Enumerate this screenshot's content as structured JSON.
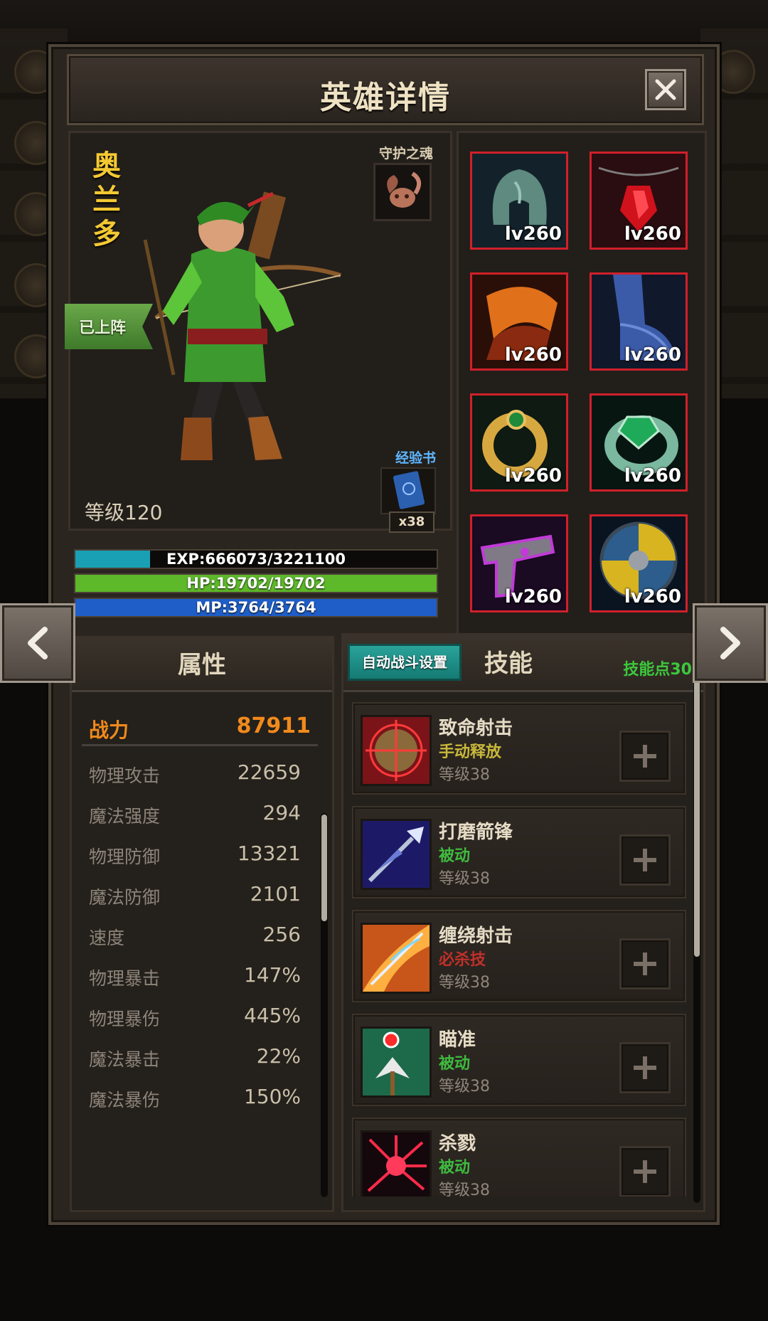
{
  "window": {
    "title": "英雄详情"
  },
  "hero": {
    "name": "奥兰多",
    "deployed_badge": "已上阵",
    "soul_label": "守护之魂",
    "expbook_label": "经验书",
    "expbook_count": "x38",
    "level_text": "等级120",
    "exp_text": "EXP:666073/3221100",
    "exp_fraction": 0.207,
    "hp_text": "HP:19702/19702",
    "hp_fraction": 1.0,
    "mp_text": "MP:3764/3764",
    "mp_fraction": 1.0
  },
  "equipment": [
    {
      "icon": "helmet-icon",
      "level": "lv260"
    },
    {
      "icon": "red-gem-necklace-icon",
      "level": "lv260"
    },
    {
      "icon": "cloak-icon",
      "level": "lv260"
    },
    {
      "icon": "boots-icon",
      "level": "lv260"
    },
    {
      "icon": "gold-ring-icon",
      "level": "lv260"
    },
    {
      "icon": "emerald-ring-icon",
      "level": "lv260"
    },
    {
      "icon": "purple-gun-icon",
      "level": "lv260"
    },
    {
      "icon": "round-shield-icon",
      "level": "lv260"
    }
  ],
  "attributes": {
    "header": "属性",
    "power_label": "战力",
    "power_value": "87911",
    "stats": [
      {
        "label": "物理攻击",
        "value": "22659"
      },
      {
        "label": "魔法强度",
        "value": "294"
      },
      {
        "label": "物理防御",
        "value": "13321"
      },
      {
        "label": "魔法防御",
        "value": "2101"
      },
      {
        "label": "速度",
        "value": "256"
      },
      {
        "label": "物理暴击",
        "value": "147%"
      },
      {
        "label": "物理暴伤",
        "value": "445%"
      },
      {
        "label": "魔法暴击",
        "value": "22%"
      },
      {
        "label": "魔法暴伤",
        "value": "150%"
      }
    ]
  },
  "skills": {
    "auto_battle_label": "自动战斗设置",
    "header": "技能",
    "skill_points": "技能点30",
    "list": [
      {
        "name": "致命射击",
        "type": "手动释放",
        "type_color": "#c8b83a",
        "level": "等级38",
        "icon": "crosshair-icon"
      },
      {
        "name": "打磨箭锋",
        "type": "被动",
        "type_color": "#3fba3f",
        "level": "等级38",
        "icon": "arrowhead-icon"
      },
      {
        "name": "缠绕射击",
        "type": "必杀技",
        "type_color": "#c0302a",
        "level": "等级38",
        "icon": "fire-arrow-icon"
      },
      {
        "name": "瞄准",
        "type": "被动",
        "type_color": "#3fba3f",
        "level": "等级38",
        "icon": "aim-icon"
      },
      {
        "name": "杀戮",
        "type": "被动",
        "type_color": "#3fba3f",
        "level": "等级38",
        "icon": "blood-burst-icon"
      }
    ]
  },
  "colors": {
    "exp_bar": "#1aa0b4",
    "hp_bar": "#5db82a",
    "mp_bar": "#1f5ec8",
    "equip_border": "#d0202a",
    "power": "#f08a1c"
  }
}
